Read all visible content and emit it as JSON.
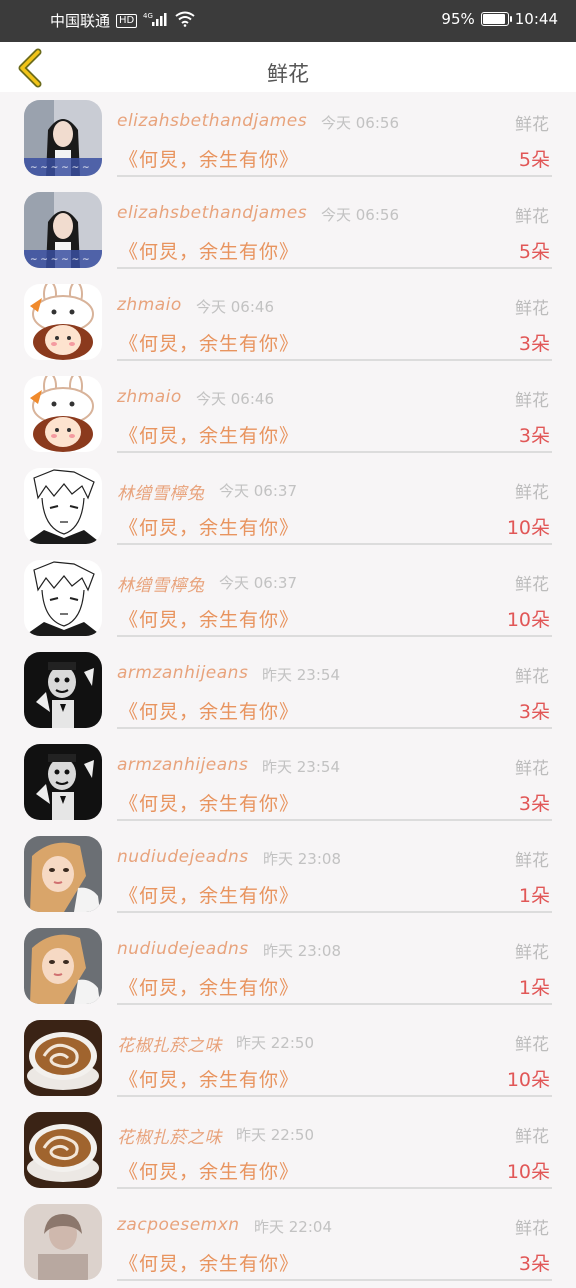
{
  "status_bar": {
    "carrier": "中国联通",
    "hd_badge": "HD",
    "network": "4G",
    "battery_percent": "95%",
    "battery_level": 0.95,
    "time": "10:44"
  },
  "header": {
    "title": "鲜花"
  },
  "rows": [
    {
      "name": "elizahsbethandjames",
      "time": "今天 06:56",
      "tag": "鲜花",
      "gift": "《何炅，余生有你》",
      "count": "5朵",
      "avatar": "girl-photo"
    },
    {
      "name": "elizahsbethandjames",
      "time": "今天 06:56",
      "tag": "鲜花",
      "gift": "《何炅，余生有你》",
      "count": "5朵",
      "avatar": "girl-photo"
    },
    {
      "name": "zhmaio",
      "time": "今天 06:46",
      "tag": "鲜花",
      "gift": "《何炅，余生有你》",
      "count": "3朵",
      "avatar": "bunny-cartoon"
    },
    {
      "name": "zhmaio",
      "time": "今天 06:46",
      "tag": "鲜花",
      "gift": "《何炅，余生有你》",
      "count": "3朵",
      "avatar": "bunny-cartoon"
    },
    {
      "name": "林缯雪檸兔",
      "time": "今天 06:37",
      "tag": "鲜花",
      "gift": "《何炅，余生有你》",
      "count": "10朵",
      "avatar": "manga-boy"
    },
    {
      "name": "林缯雪檸兔",
      "time": "今天 06:37",
      "tag": "鲜花",
      "gift": "《何炅，余生有你》",
      "count": "10朵",
      "avatar": "manga-boy"
    },
    {
      "name": "armzanhijeans",
      "time": "昨天 23:54",
      "tag": "鲜花",
      "gift": "《何炅，余生有你》",
      "count": "3朵",
      "avatar": "mime-bw"
    },
    {
      "name": "armzanhijeans",
      "time": "昨天 23:54",
      "tag": "鲜花",
      "gift": "《何炅，余生有你》",
      "count": "3朵",
      "avatar": "mime-bw"
    },
    {
      "name": "nudiudejeadns",
      "time": "昨天 23:08",
      "tag": "鲜花",
      "gift": "《何炅，余生有你》",
      "count": "1朵",
      "avatar": "blonde-girl"
    },
    {
      "name": "nudiudejeadns",
      "time": "昨天 23:08",
      "tag": "鲜花",
      "gift": "《何炅，余生有你》",
      "count": "1朵",
      "avatar": "blonde-girl"
    },
    {
      "name": "花椒扎菸之味",
      "time": "昨天 22:50",
      "tag": "鲜花",
      "gift": "《何炅，余生有你》",
      "count": "10朵",
      "avatar": "latte-art"
    },
    {
      "name": "花椒扎菸之味",
      "time": "昨天 22:50",
      "tag": "鲜花",
      "gift": "《何炅，余生有你》",
      "count": "10朵",
      "avatar": "latte-art"
    },
    {
      "name": "zacpoesemxn",
      "time": "昨天 22:04",
      "tag": "鲜花",
      "gift": "《何炅，余生有你》",
      "count": "3朵",
      "avatar": "faded-photo"
    }
  ]
}
